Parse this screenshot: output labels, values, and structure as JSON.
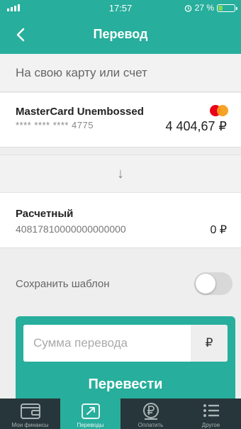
{
  "status_bar": {
    "time": "17:57",
    "battery_text": "27 %",
    "battery_level_percent": 27,
    "alarm_icon": "alarm-icon",
    "signal_icon": "signal-icon"
  },
  "nav": {
    "title": "Перевод",
    "back_icon": "back-chevron-icon"
  },
  "subheader": "На свою карту или счет",
  "source_card": {
    "name": "MasterCard Unembossed",
    "masked_number": "**** **** **** 4775",
    "balance": "4 404,67 ₽",
    "logo_icon": "mastercard-logo-icon"
  },
  "direction_arrow": "↓",
  "target_account": {
    "name": "Расчетный",
    "number": "40817810000000000000",
    "balance": "0 ₽"
  },
  "save_template": {
    "label": "Сохранить шаблон",
    "enabled": false
  },
  "transfer_form": {
    "amount_placeholder": "Сумма перевода",
    "amount_value": "",
    "currency_symbol": "₽",
    "submit_label": "Перевести"
  },
  "tab_bar": {
    "active_index": 1,
    "items": [
      {
        "label": "Мои финансы",
        "icon": "wallet-icon"
      },
      {
        "label": "Переводы",
        "icon": "transfer-icon"
      },
      {
        "label": "Оплатить",
        "icon": "ruble-coin-icon"
      },
      {
        "label": "Другое",
        "icon": "menu-list-icon"
      }
    ]
  },
  "colors": {
    "accent": "#27ae9c",
    "tab_bar_bg": "#27363a",
    "background": "#eeeeee"
  }
}
